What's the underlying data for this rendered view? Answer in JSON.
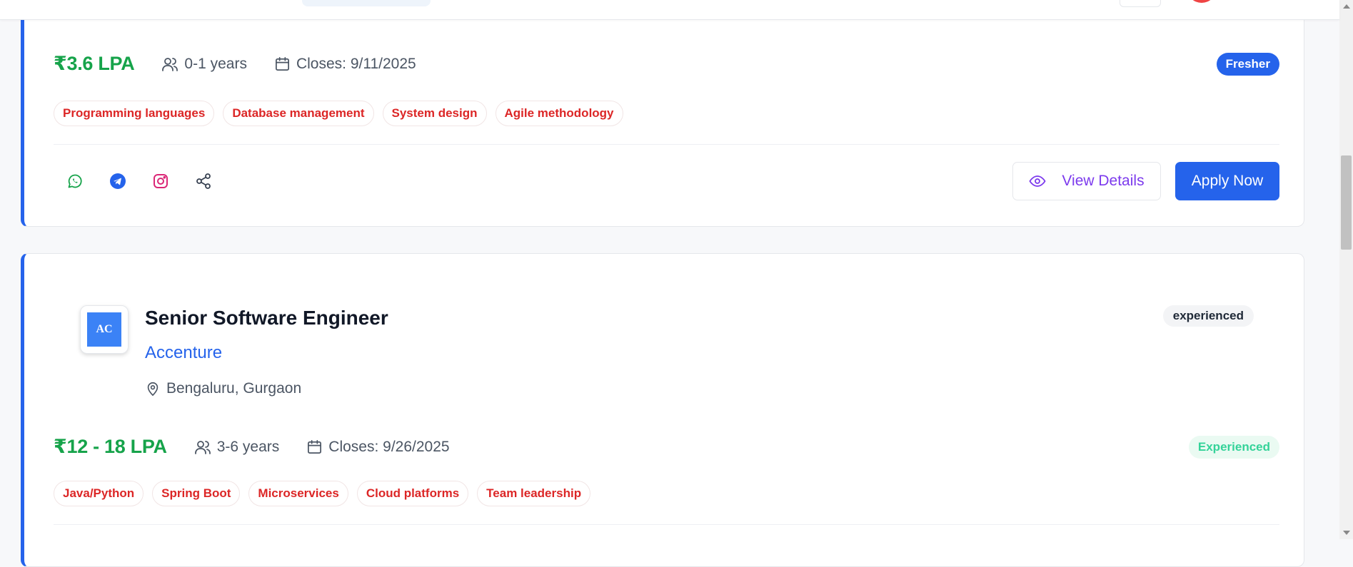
{
  "jobs": [
    {
      "salary": "₹3.6 LPA",
      "experience": "0-1 years",
      "closes": "Closes: 9/11/2025",
      "badge": "Fresher",
      "skills": [
        "Programming languages",
        "Database management",
        "System design",
        "Agile methodology"
      ],
      "share_icons": [
        "whatsapp-icon",
        "telegram-icon",
        "instagram-icon",
        "share-icon"
      ],
      "view_details_label": "View Details",
      "apply_label": "Apply Now"
    },
    {
      "logo_text": "AC",
      "title": "Senior Software Engineer",
      "company": "Accenture",
      "location": "Bengaluru, Gurgaon",
      "level_tag": "experienced",
      "salary": "₹12 - 18 LPA",
      "experience": "3-6 years",
      "closes": "Closes: 9/26/2025",
      "badge": "Experienced",
      "skills": [
        "Java/Python",
        "Spring Boot",
        "Microservices",
        "Cloud platforms",
        "Team leadership"
      ]
    }
  ],
  "colors": {
    "accent": "#2563eb",
    "salary": "#16a34a",
    "skill_text": "#dc2626",
    "view_details": "#7c3aed",
    "experienced_badge": "#34d399"
  }
}
